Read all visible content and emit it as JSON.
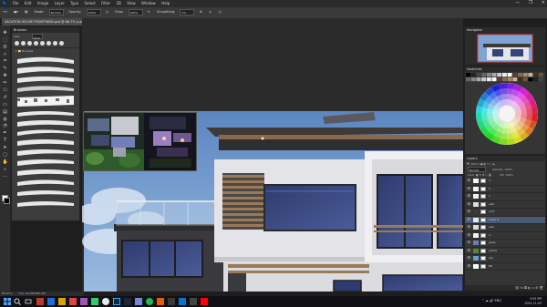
{
  "app": {
    "logo": "Ps",
    "window_controls": [
      "—",
      "❐",
      "✕"
    ]
  },
  "menu": [
    "File",
    "Edit",
    "Image",
    "Layer",
    "Type",
    "Select",
    "Filter",
    "3D",
    "View",
    "Window",
    "Help"
  ],
  "options": {
    "mode_label": "Mode:",
    "mode_value": "Normal",
    "opacity_label": "Opacity:",
    "opacity_value": "100%",
    "flow_label": "Flow:",
    "flow_value": "100%",
    "smoothing_label": "Smoothing:",
    "smoothing_value": "0%"
  },
  "document": {
    "tab_title": "VACATION HOUSE FRONTYARD.psd @ 66.7% (Layer 5, RGB/8) *",
    "zoom": "66.67%",
    "doc_size": "Doc: 24.9M/362.2M"
  },
  "tools": [
    "move-icon",
    "marquee-icon",
    "lasso-icon",
    "magic-wand-icon",
    "crop-icon",
    "eyedropper-icon",
    "healing-icon",
    "brush-icon",
    "stamp-icon",
    "history-brush-icon",
    "eraser-icon",
    "gradient-icon",
    "blur-icon",
    "dodge-icon",
    "pen-icon",
    "type-icon",
    "path-select-icon",
    "shape-icon",
    "hand-icon",
    "zoom-icon",
    "more-icon"
  ],
  "tool_glyphs": [
    "✥",
    "⬚",
    "ʘ",
    "✧",
    "⌗",
    "✎",
    "✚",
    "✏",
    "⎔",
    "↺",
    "▭",
    "▤",
    "◍",
    "◔",
    "✒",
    "T",
    "➤",
    "▢",
    "✋",
    "⌕",
    "⋯"
  ],
  "brushes": {
    "title": "Brushes",
    "size_label": "Size:",
    "size_value": "10 px",
    "folder": "Brushes"
  },
  "navigator": {
    "title": "Navigator"
  },
  "swatches": {
    "title": "Swatches"
  },
  "layers": {
    "title": "Layers",
    "kind_label": "Kind",
    "blend_mode": "Normal",
    "opacity_label": "Opacity:",
    "opacity_value": "100%",
    "fill_label": "Fill:",
    "fill_value": "100%",
    "rows": [
      {
        "name": "3"
      },
      {
        "name": "2"
      },
      {
        "name": "1"
      },
      {
        "name": "wall"
      },
      {
        "name": "roof"
      },
      {
        "name": "Layer 5"
      },
      {
        "name": "wall"
      },
      {
        "name": "4"
      },
      {
        "name": "glass"
      },
      {
        "name": "plants"
      },
      {
        "name": "sky"
      },
      {
        "name": "BG"
      }
    ]
  },
  "taskbar": {
    "lang": "ENG",
    "time": "3:55 PM",
    "date": "2021-11-03"
  },
  "colors": {
    "accent": "#31a8ff",
    "selected_layer": "#4a5a72",
    "sky": "#6e99cf",
    "wall": "#e6e6ea",
    "window": "#34437a",
    "wood": "#8a6a4a",
    "roof": "#3d3a38"
  }
}
